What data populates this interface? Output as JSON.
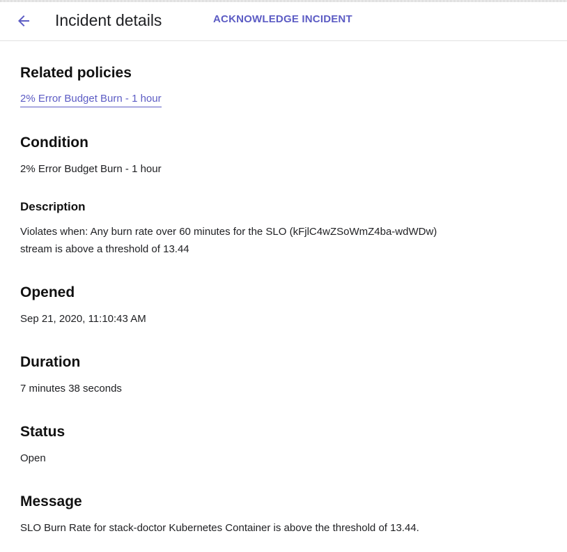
{
  "header": {
    "back_icon": "arrow-back-icon",
    "title": "Incident details",
    "acknowledge_label": "ACKNOWLEDGE INCIDENT",
    "accent_color": "#5c5cc4"
  },
  "sections": {
    "related_policies": {
      "heading": "Related policies",
      "link_text": "2% Error Budget Burn - 1 hour"
    },
    "condition": {
      "heading": "Condition",
      "value": "2% Error Budget Burn - 1 hour"
    },
    "description": {
      "heading": "Description",
      "line1": "Violates when: Any burn rate over 60 minutes for the SLO (kFjlC4wZSoWmZ4ba-wdWDw)",
      "line2": "stream is above a threshold of 13.44"
    },
    "opened": {
      "heading": "Opened",
      "value": "Sep 21, 2020, 11:10:43 AM"
    },
    "duration": {
      "heading": "Duration",
      "value": "7 minutes 38 seconds"
    },
    "status": {
      "heading": "Status",
      "value": "Open"
    },
    "message": {
      "heading": "Message",
      "value": "SLO Burn Rate for stack-doctor Kubernetes Container is above the threshold of 13.44."
    }
  }
}
